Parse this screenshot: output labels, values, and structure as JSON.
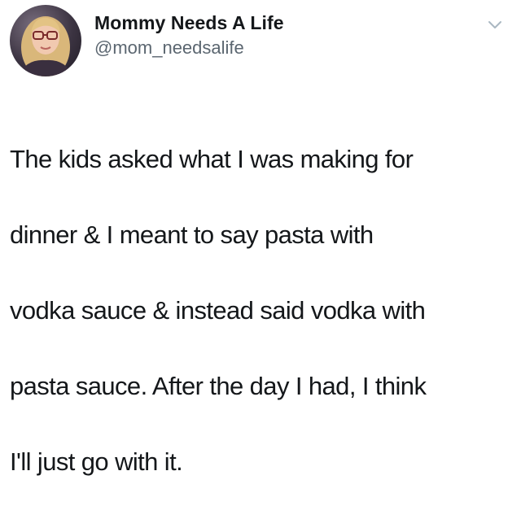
{
  "tweet": {
    "author": {
      "display_name": "Mommy Needs A Life",
      "handle": "@mom_needsalife",
      "avatar_icon": "profile-photo"
    },
    "menu_icon": "chevron-down-icon",
    "text_lines": [
      "The kids asked what I was making for",
      "dinner & I meant to say pasta with",
      "vodka sauce & instead said vodka with",
      "pasta sauce. After the day I had, I think",
      "I'll just go with it."
    ]
  },
  "colors": {
    "text": "#14171a",
    "secondary_text": "#5b6670",
    "chevron": "#aab8c2",
    "background": "#ffffff"
  }
}
